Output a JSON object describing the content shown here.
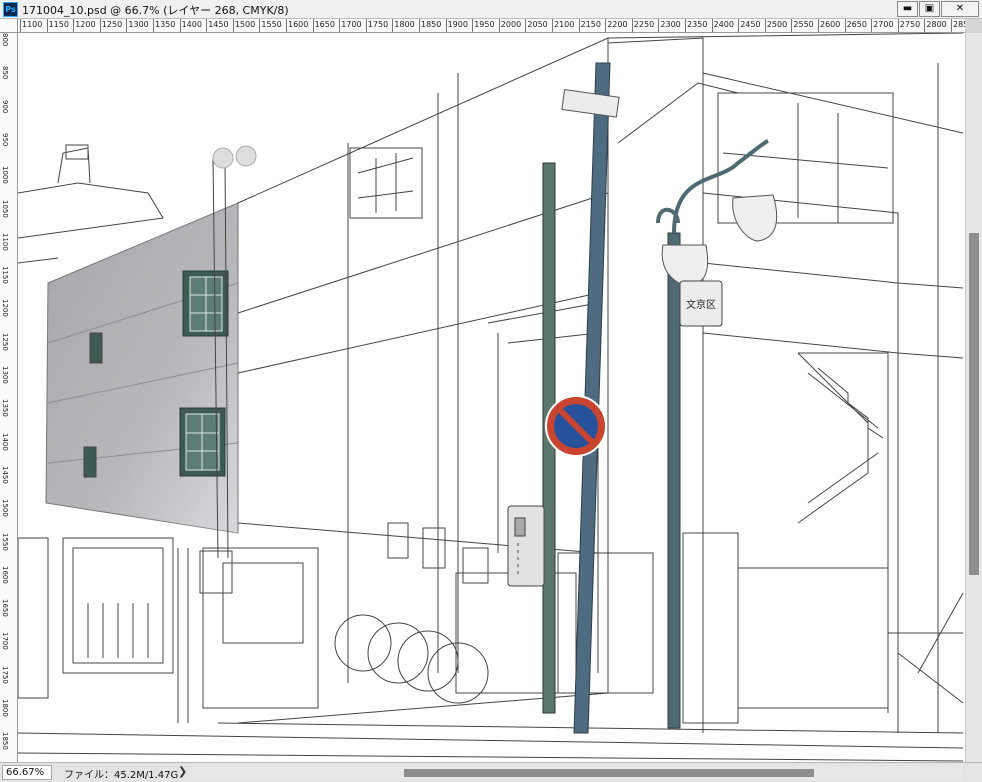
{
  "window": {
    "app_icon_label": "Ps",
    "title": "171004_10.psd @ 66.7% (レイヤー 268, CMYK/8)",
    "minimize_glyph": "▬",
    "maximize_glyph": "▣",
    "close_glyph": "✕"
  },
  "ruler_horizontal": [
    "1100",
    "1150",
    "1200",
    "1250",
    "1300",
    "1350",
    "1400",
    "1450",
    "1500",
    "1550",
    "1600",
    "1650",
    "1700",
    "1750",
    "1800",
    "1850",
    "1900",
    "1950",
    "2000",
    "2050",
    "2100",
    "2150",
    "2200",
    "2250",
    "2300",
    "2350",
    "2400",
    "2450",
    "2500",
    "2550",
    "2600",
    "2650",
    "2700",
    "2750",
    "2800",
    "285"
  ],
  "ruler_vertical": [
    "800",
    "850",
    "900",
    "950",
    "1000",
    "1050",
    "1100",
    "1150",
    "1200",
    "1250",
    "1300",
    "1350",
    "1400",
    "1450",
    "1500",
    "1550",
    "1600",
    "1650",
    "1700",
    "1750",
    "1800",
    "1850"
  ],
  "status": {
    "zoom": "66.67%",
    "file_info": "ファイル：45.2M/1.47G",
    "menu_arrow": "❯"
  },
  "icons": {
    "app": "photoshop-icon",
    "minimize": "minimize-icon",
    "maximize": "maximize-icon",
    "close": "close-icon"
  },
  "artwork": {
    "sign_text": "文京区",
    "colors": {
      "gray_wall": "#a9a9ac",
      "window_green": "#3d5b52",
      "pole_blue": "#4e6b80",
      "pole_green": "#5b776d",
      "sign_red": "#c9452f",
      "sign_blue": "#27519c"
    }
  }
}
